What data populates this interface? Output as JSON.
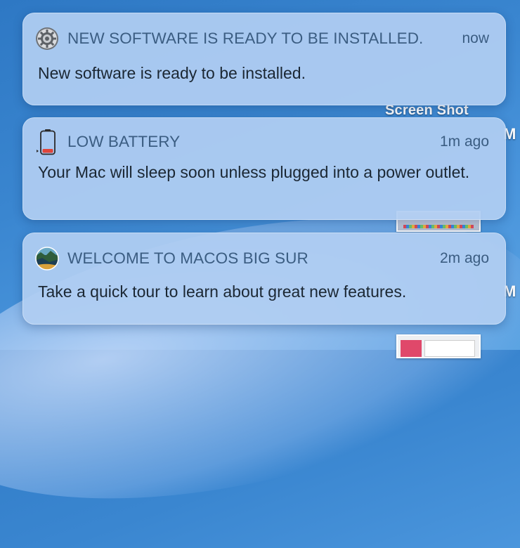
{
  "desktop": {
    "label": "Screen Shot",
    "label_fragment_1": "M",
    "label_fragment_2": "M"
  },
  "notifications": [
    {
      "icon": "gear-icon",
      "app": "NEW SOFTWARE IS READY TO BE INSTALLED.",
      "time": "now",
      "message": "New software is ready to be installed."
    },
    {
      "icon": "battery-icon",
      "app": "LOW BATTERY",
      "time": "1m ago",
      "message": "Your Mac will sleep soon unless plugged into a power outlet."
    },
    {
      "icon": "big-sur-icon",
      "app": "WELCOME TO MACOS BIG SUR",
      "time": "2m ago",
      "message": "Take a quick tour to learn about great new features."
    }
  ],
  "colors": {
    "card_background": "#b0cef2",
    "header_text": "#3b5d82",
    "body_text": "#1b2733",
    "battery_low": "#e0453a"
  }
}
